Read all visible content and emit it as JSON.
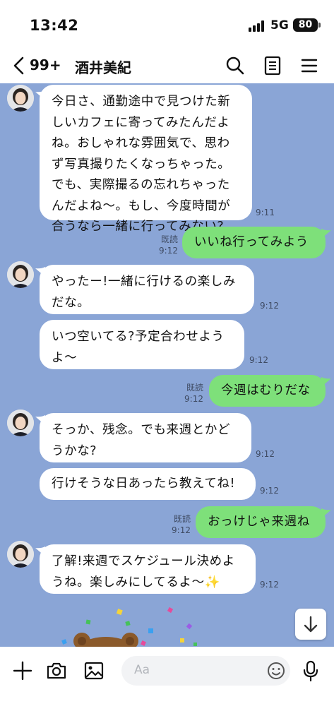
{
  "status_bar": {
    "time": "13:42",
    "network": "5G",
    "battery": "80"
  },
  "header": {
    "unread_count": "99+",
    "contact_name": "酒井美紀"
  },
  "messages": [
    {
      "text": "今日さ、通勤途中で見つけた新\nしいカフェに寄ってみたんだよ\nね。おしゃれな雰囲気で、思わ\nず写真撮りたくなっちゃった。\nでも、実際撮るの忘れちゃった\nんだよね〜。もし、今度時間が\n合うなら一緒に行ってみない?",
      "time": "9:11"
    },
    {
      "text": "いいね行ってみよう",
      "time": "9:12",
      "read": "既読"
    },
    {
      "text": "やったー!一緒に行けるの楽しみ\nだな。",
      "time": "9:12"
    },
    {
      "text": "いつ空いてる?予定合わせよう\nよ〜",
      "time": "9:12"
    },
    {
      "text": "今週はむりだな",
      "time": "9:12",
      "read": "既読"
    },
    {
      "text": "そっか、残念。でも来週とかど\nうかな?",
      "time": "9:12"
    },
    {
      "text": "行けそうな日あったら教えてね!",
      "time": "9:12"
    },
    {
      "text": "おっけじゃ来週ね",
      "time": "9:12",
      "read": "既読"
    },
    {
      "text": "了解!来週でスケジュール決めよ\nうね。楽しみにしてるよ〜✨",
      "time": "9:12"
    }
  ],
  "input": {
    "placeholder": "Aa"
  },
  "icons": {
    "back": "chevron-left-icon",
    "search": "search-icon",
    "notes": "notes-icon",
    "menu": "hamburger-icon",
    "plus": "plus-icon",
    "camera": "camera-icon",
    "image": "image-icon",
    "emoji": "emoji-icon",
    "mic": "microphone-icon",
    "scroll": "arrow-down-icon"
  },
  "colors": {
    "chat_bg": "#8aa5d6",
    "sent_bubble": "#7ee07a",
    "received_bubble": "#ffffff"
  }
}
